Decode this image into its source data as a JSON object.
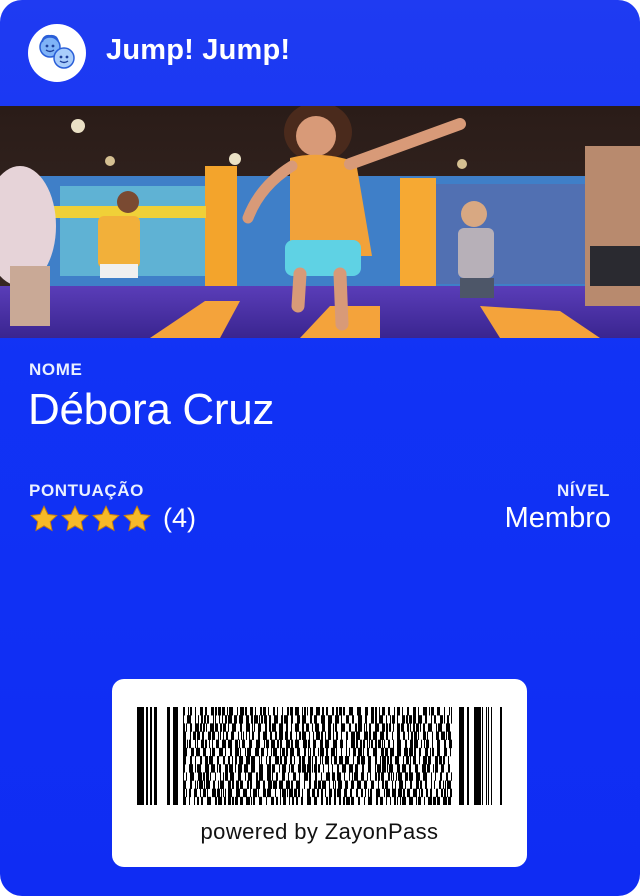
{
  "app": {
    "title": "Jump! Jump!"
  },
  "header": {
    "logo_icon": "kids-faces-icon"
  },
  "hero": {
    "image_description_icon": "trampoline-park-photo"
  },
  "fields": {
    "name": {
      "label": "NOME",
      "value": "Débora Cruz"
    },
    "score": {
      "label": "PONTUAÇÃO",
      "stars": 4,
      "text": "(4)"
    },
    "level": {
      "label": "NÍVEL",
      "value": "Membro"
    }
  },
  "barcode": {
    "footer": "powered by ZayonPass"
  },
  "colors": {
    "card_bg": "#1133f5",
    "accent": "#ffffff",
    "star": "#f7b928"
  }
}
